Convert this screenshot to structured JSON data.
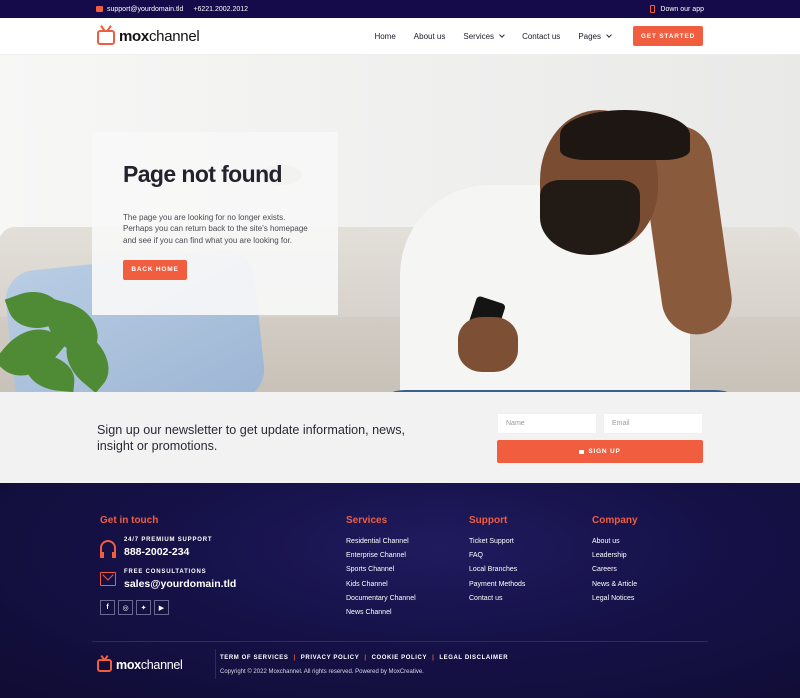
{
  "topbar": {
    "email": "support@yourdomain.tld",
    "phone": "+6221.2002.2012",
    "app_link": "Down our app"
  },
  "header": {
    "logo_bold": "mox",
    "logo_rest": "channel",
    "nav": [
      "Home",
      "About us",
      "Services",
      "Contact us",
      "Pages"
    ],
    "cta": "GET STARTED"
  },
  "hero": {
    "title": "Page not found",
    "body": "The page you are looking for no longer exists. Perhaps you can return back to the site's homepage and see if you can find what you are looking for.",
    "button": "BACK HOME"
  },
  "newsletter": {
    "text": "Sign up our newsletter to get update information, news, insight or promotions.",
    "name_placeholder": "Name",
    "email_placeholder": "Email",
    "button": "SIGN UP"
  },
  "footer": {
    "contact_title": "Get in touch",
    "support_label": "24/7 PREMIUM SUPPORT",
    "support_value": "888-2002-234",
    "consult_label": "FREE CONSULTATIONS",
    "consult_value": "sales@yourdomain.tld",
    "socials": [
      "f",
      "ig",
      "tw",
      "yt"
    ],
    "columns": [
      {
        "title": "Services",
        "items": [
          "Residential Channel",
          "Enterprise Channel",
          "Sports Channel",
          "Kids Channel",
          "Documentary Channel",
          "News Channel"
        ]
      },
      {
        "title": "Support",
        "items": [
          "Ticket Support",
          "FAQ",
          "Local Branches",
          "Payment Methods",
          "Contact us"
        ]
      },
      {
        "title": "Company",
        "items": [
          "About us",
          "Leadership",
          "Careers",
          "News & Article",
          "Legal Notices"
        ]
      }
    ],
    "legal": [
      "TERM OF SERVICES",
      "PRIVACY POLICY",
      "COOKIE POLICY",
      "LEGAL DISCLAIMER"
    ],
    "copyright": "Copyright © 2022 Moxchannel. All rights reserved. Powered by MoxCreative."
  },
  "colors": {
    "accent": "#f15d3f",
    "dark": "#150a4a",
    "footer": "#16124a"
  }
}
